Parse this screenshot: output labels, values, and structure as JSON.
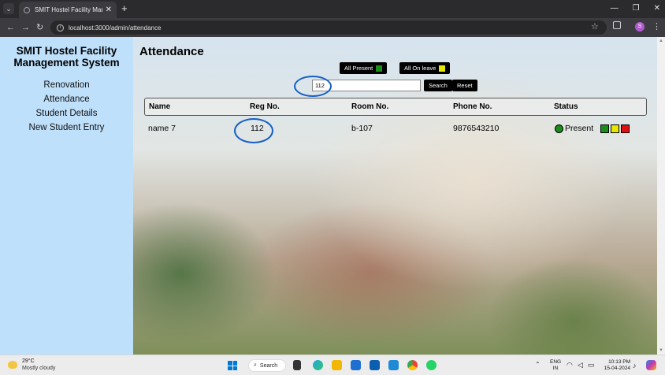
{
  "browser": {
    "tab_title": "SMIT Hostel Facility Manageme",
    "tab_close": "✕",
    "new_tab": "+",
    "url": "localhost:3000/admin/attendance",
    "profile_initial": "S"
  },
  "sidebar": {
    "brand_line1": "SMIT Hostel Facility",
    "brand_line2": "Management System",
    "items": [
      {
        "label": "Renovation"
      },
      {
        "label": "Attendance"
      },
      {
        "label": "Student Details"
      },
      {
        "label": "New Student Entry"
      }
    ]
  },
  "main": {
    "title": "Attendance",
    "all_present_label": "All Present",
    "all_on_leave_label": "All On leave",
    "search_value": "112",
    "search_button": "Search",
    "reset_button": "Reset",
    "table": {
      "headers": [
        "Name",
        "Reg No.",
        "Room No.",
        "Phone No.",
        "Status"
      ],
      "rows": [
        {
          "name": "name 7",
          "reg_no": "112",
          "room_no": "b-107",
          "phone": "9876543210",
          "status": "Present"
        }
      ]
    }
  },
  "colors": {
    "present": "#1a8d1a",
    "on_leave": "#e6e600",
    "absent": "#e01010",
    "sidebar_bg": "#bfe0fb",
    "annotation": "#1560c8"
  },
  "taskbar": {
    "temperature": "29°C",
    "weather": "Mostly cloudy",
    "search_label": "Search",
    "lang_line1": "ENG",
    "lang_line2": "IN",
    "time": "10:13 PM",
    "date": "15-04-2024"
  }
}
